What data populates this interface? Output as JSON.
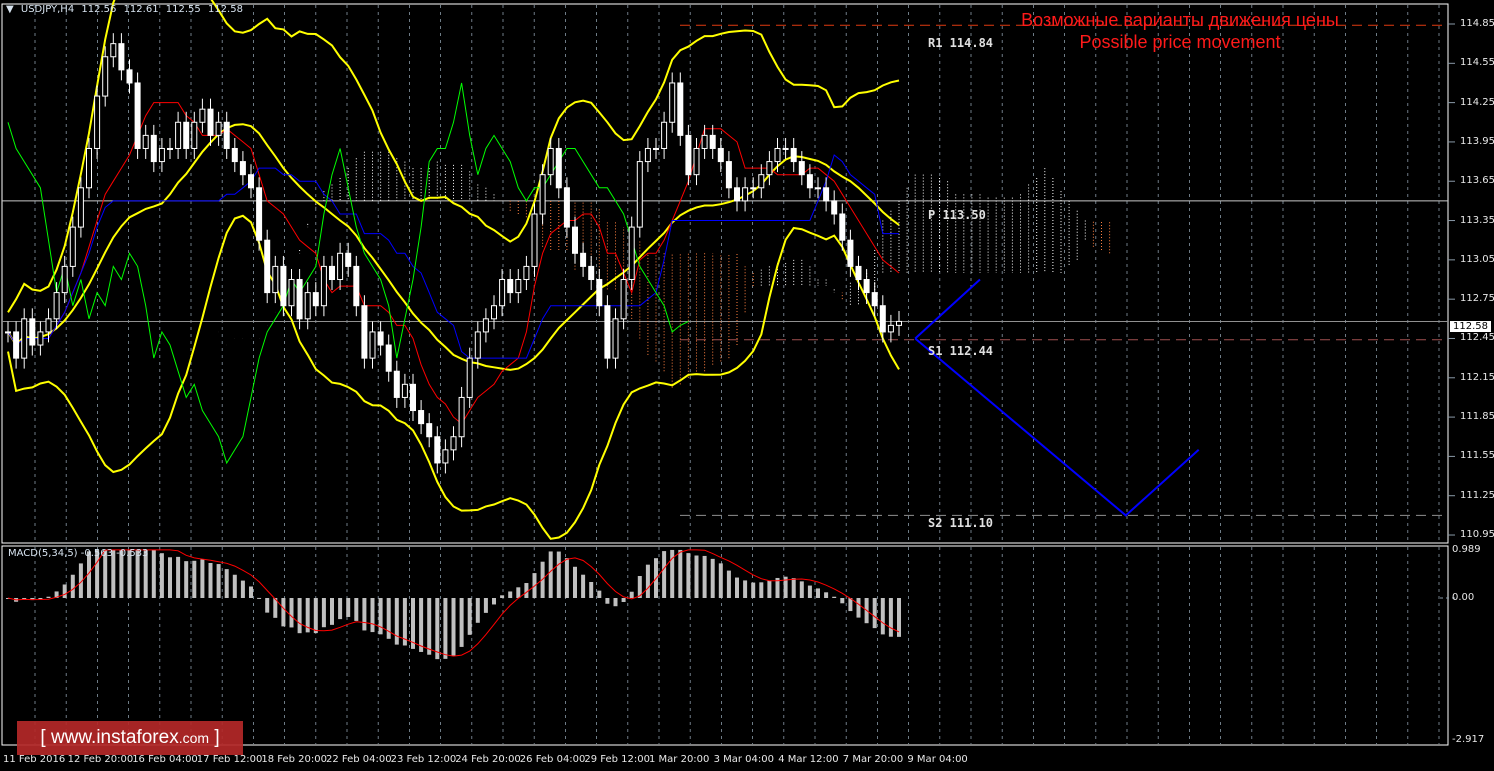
{
  "header": {
    "symbol": "USDJPY,H4",
    "open": "112.56",
    "high": "112.61",
    "low": "112.55",
    "close": "112.58"
  },
  "title": {
    "line1": "Возможные варианты движения цены",
    "line2": "Possible price movement"
  },
  "levels": [
    {
      "label": "R1 114.84",
      "value": 114.84,
      "color": "#e03a10",
      "style": "dashed"
    },
    {
      "label": "P 113.50",
      "value": 113.5,
      "color": "#c8c8c8",
      "style": "solid"
    },
    {
      "label": "S1 112.44",
      "value": 112.44,
      "color": "#a05050",
      "style": "dashed"
    },
    {
      "label": "S2 111.10",
      "value": 111.1,
      "color": "#909090",
      "style": "dashed"
    }
  ],
  "current_price": "112.58",
  "price_axis": [
    "114.85",
    "114.55",
    "114.25",
    "113.95",
    "113.65",
    "113.35",
    "113.05",
    "112.75",
    "112.45",
    "112.15",
    "111.85",
    "111.55",
    "111.25",
    "110.95"
  ],
  "macd_axis": [
    "0.989",
    "0.00",
    "-2.917"
  ],
  "macd_label": "MACD(5,34,5) -0.563 -0.533",
  "time_axis": [
    "11 Feb 2016",
    "12 Feb 20:00",
    "16 Feb 04:00",
    "17 Feb 12:00",
    "18 Feb 20:00",
    "22 Feb 04:00",
    "23 Feb 12:00",
    "24 Feb 20:00",
    "26 Feb 04:00",
    "29 Feb 12:00",
    "1 Mar 20:00",
    "3 Mar 04:00",
    "4 Mar 12:00",
    "7 Mar 20:00",
    "9 Mar 04:00"
  ],
  "watermark": {
    "text": "www.instaforex",
    "suffix": ".com",
    "bracket_open": "[",
    "bracket_close": "]"
  },
  "chart_data": {
    "type": "candlestick",
    "timeframe": "H4",
    "ylim": [
      110.95,
      114.85
    ],
    "grid": true,
    "closes": [
      112.5,
      112.3,
      112.6,
      112.4,
      112.5,
      112.6,
      112.8,
      113.0,
      113.3,
      113.6,
      113.9,
      114.3,
      114.6,
      114.7,
      114.5,
      114.4,
      113.9,
      114.0,
      113.8,
      113.9,
      113.9,
      114.1,
      113.9,
      114.1,
      114.2,
      114.0,
      114.1,
      113.9,
      113.8,
      113.7,
      113.6,
      113.2,
      112.8,
      113.0,
      112.7,
      112.9,
      112.6,
      112.8,
      112.7,
      113.0,
      112.9,
      113.1,
      113.0,
      112.7,
      112.3,
      112.5,
      112.4,
      112.2,
      112.0,
      112.1,
      111.9,
      111.8,
      111.7,
      111.5,
      111.6,
      111.7,
      112.0,
      112.3,
      112.5,
      112.6,
      112.7,
      112.9,
      112.8,
      112.9,
      113.0,
      113.4,
      113.7,
      113.9,
      113.6,
      113.3,
      113.1,
      113.0,
      112.9,
      112.7,
      112.3,
      112.6,
      112.9,
      113.3,
      113.8,
      113.9,
      113.9,
      114.1,
      114.4,
      114.0,
      113.7,
      113.9,
      114.0,
      113.9,
      113.8,
      113.6,
      113.5,
      113.6,
      113.6,
      113.7,
      113.8,
      113.9,
      113.9,
      113.8,
      113.7,
      113.6,
      113.6,
      113.5,
      113.4,
      113.2,
      113.0,
      112.9,
      112.8,
      112.7,
      112.5,
      112.55,
      112.58
    ],
    "indicators": {
      "bollinger": {
        "period": 20,
        "deviations": 2,
        "color": "#ffff00"
      },
      "ichimoku": {
        "tenkan": 9,
        "kijun": 26,
        "senkou": 52,
        "tenkan_color": "#ff0000",
        "kijun_color": "#0000ff",
        "chikou_color": "#00ff00",
        "cloud_up_color": "#ffffff",
        "cloud_down_color": "#ff8040"
      },
      "macd": {
        "fast": 5,
        "slow": 34,
        "signal": 5,
        "histogram_color": "#c0c0c0",
        "signal_color": "#ff0000",
        "value": -0.563,
        "signal_value": -0.533,
        "ylim": [
          -2.917,
          0.989
        ]
      }
    },
    "forecast": {
      "color": "#0000ff",
      "paths": [
        [
          {
            "bars_ahead": 2,
            "price": 112.45
          },
          {
            "bars_ahead": 10,
            "price": 112.9
          }
        ],
        [
          {
            "bars_ahead": 2,
            "price": 112.45
          },
          {
            "bars_ahead": 28,
            "price": 111.1
          },
          {
            "bars_ahead": 37,
            "price": 111.6
          }
        ]
      ]
    }
  }
}
